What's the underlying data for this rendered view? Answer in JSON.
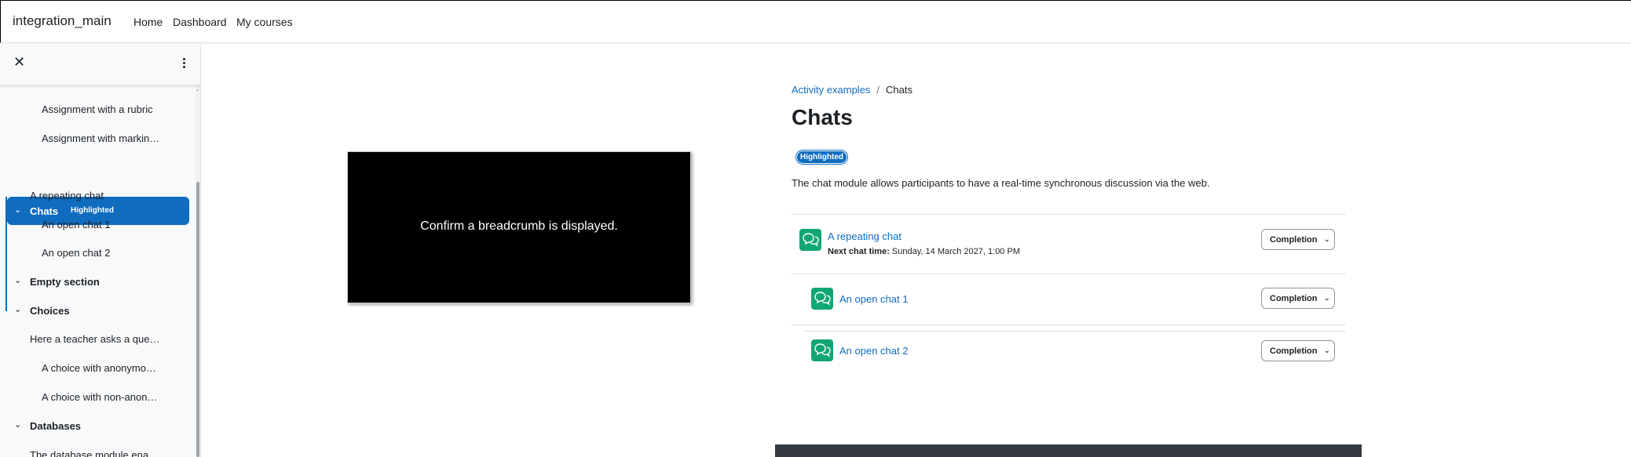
{
  "navbar": {
    "brand": "integration_main",
    "items": [
      "Home",
      "Dashboard",
      "My courses"
    ]
  },
  "drawer": {
    "close_glyph": "✕",
    "items": [
      {
        "label": "Assignment with a rubric",
        "level": 2
      },
      {
        "label": "Assignment with markin…",
        "level": 2
      },
      {
        "label": "A repeating chat",
        "level": 1
      },
      {
        "label": "An open chat 1",
        "level": 2
      },
      {
        "label": "An open chat 2",
        "level": 2
      },
      {
        "label": "Empty section",
        "level": 0
      },
      {
        "label": "Choices",
        "level": 0
      },
      {
        "label": "Here a teacher asks a que…",
        "level": 1
      },
      {
        "label": "A choice with anonymo…",
        "level": 2
      },
      {
        "label": "A choice with non-anon…",
        "level": 2
      },
      {
        "label": "Databases",
        "level": 0
      },
      {
        "label": "The database module ena…",
        "level": 1
      }
    ],
    "active": {
      "label": "Chats",
      "badge": "Highlighted"
    }
  },
  "main": {
    "breadcrumb": [
      {
        "label": "Activity examples",
        "link": true
      },
      {
        "label": "Chats",
        "link": false
      }
    ],
    "breadcrumb_separator": "/",
    "title": "Chats",
    "badge": "Highlighted",
    "description": "The chat module allows participants to have a real-time synchronous discussion via the web.",
    "activities": [
      {
        "name": "A repeating chat",
        "meta_label": "Next chat time:",
        "meta_value": "Sunday, 14 March 2027, 1:00 PM",
        "completion": "Completion"
      },
      {
        "name": "An open chat 1",
        "completion": "Completion"
      },
      {
        "name": "An open chat 2",
        "completion": "Completion"
      }
    ]
  },
  "overlay": {
    "text": "Confirm a breadcrumb is displayed."
  },
  "icons": {
    "activity": "chat-bubbles-icon",
    "caret": "chevron-down-icon"
  },
  "colors": {
    "accent": "#0f6cbf",
    "activity_icon": "#11a676"
  }
}
